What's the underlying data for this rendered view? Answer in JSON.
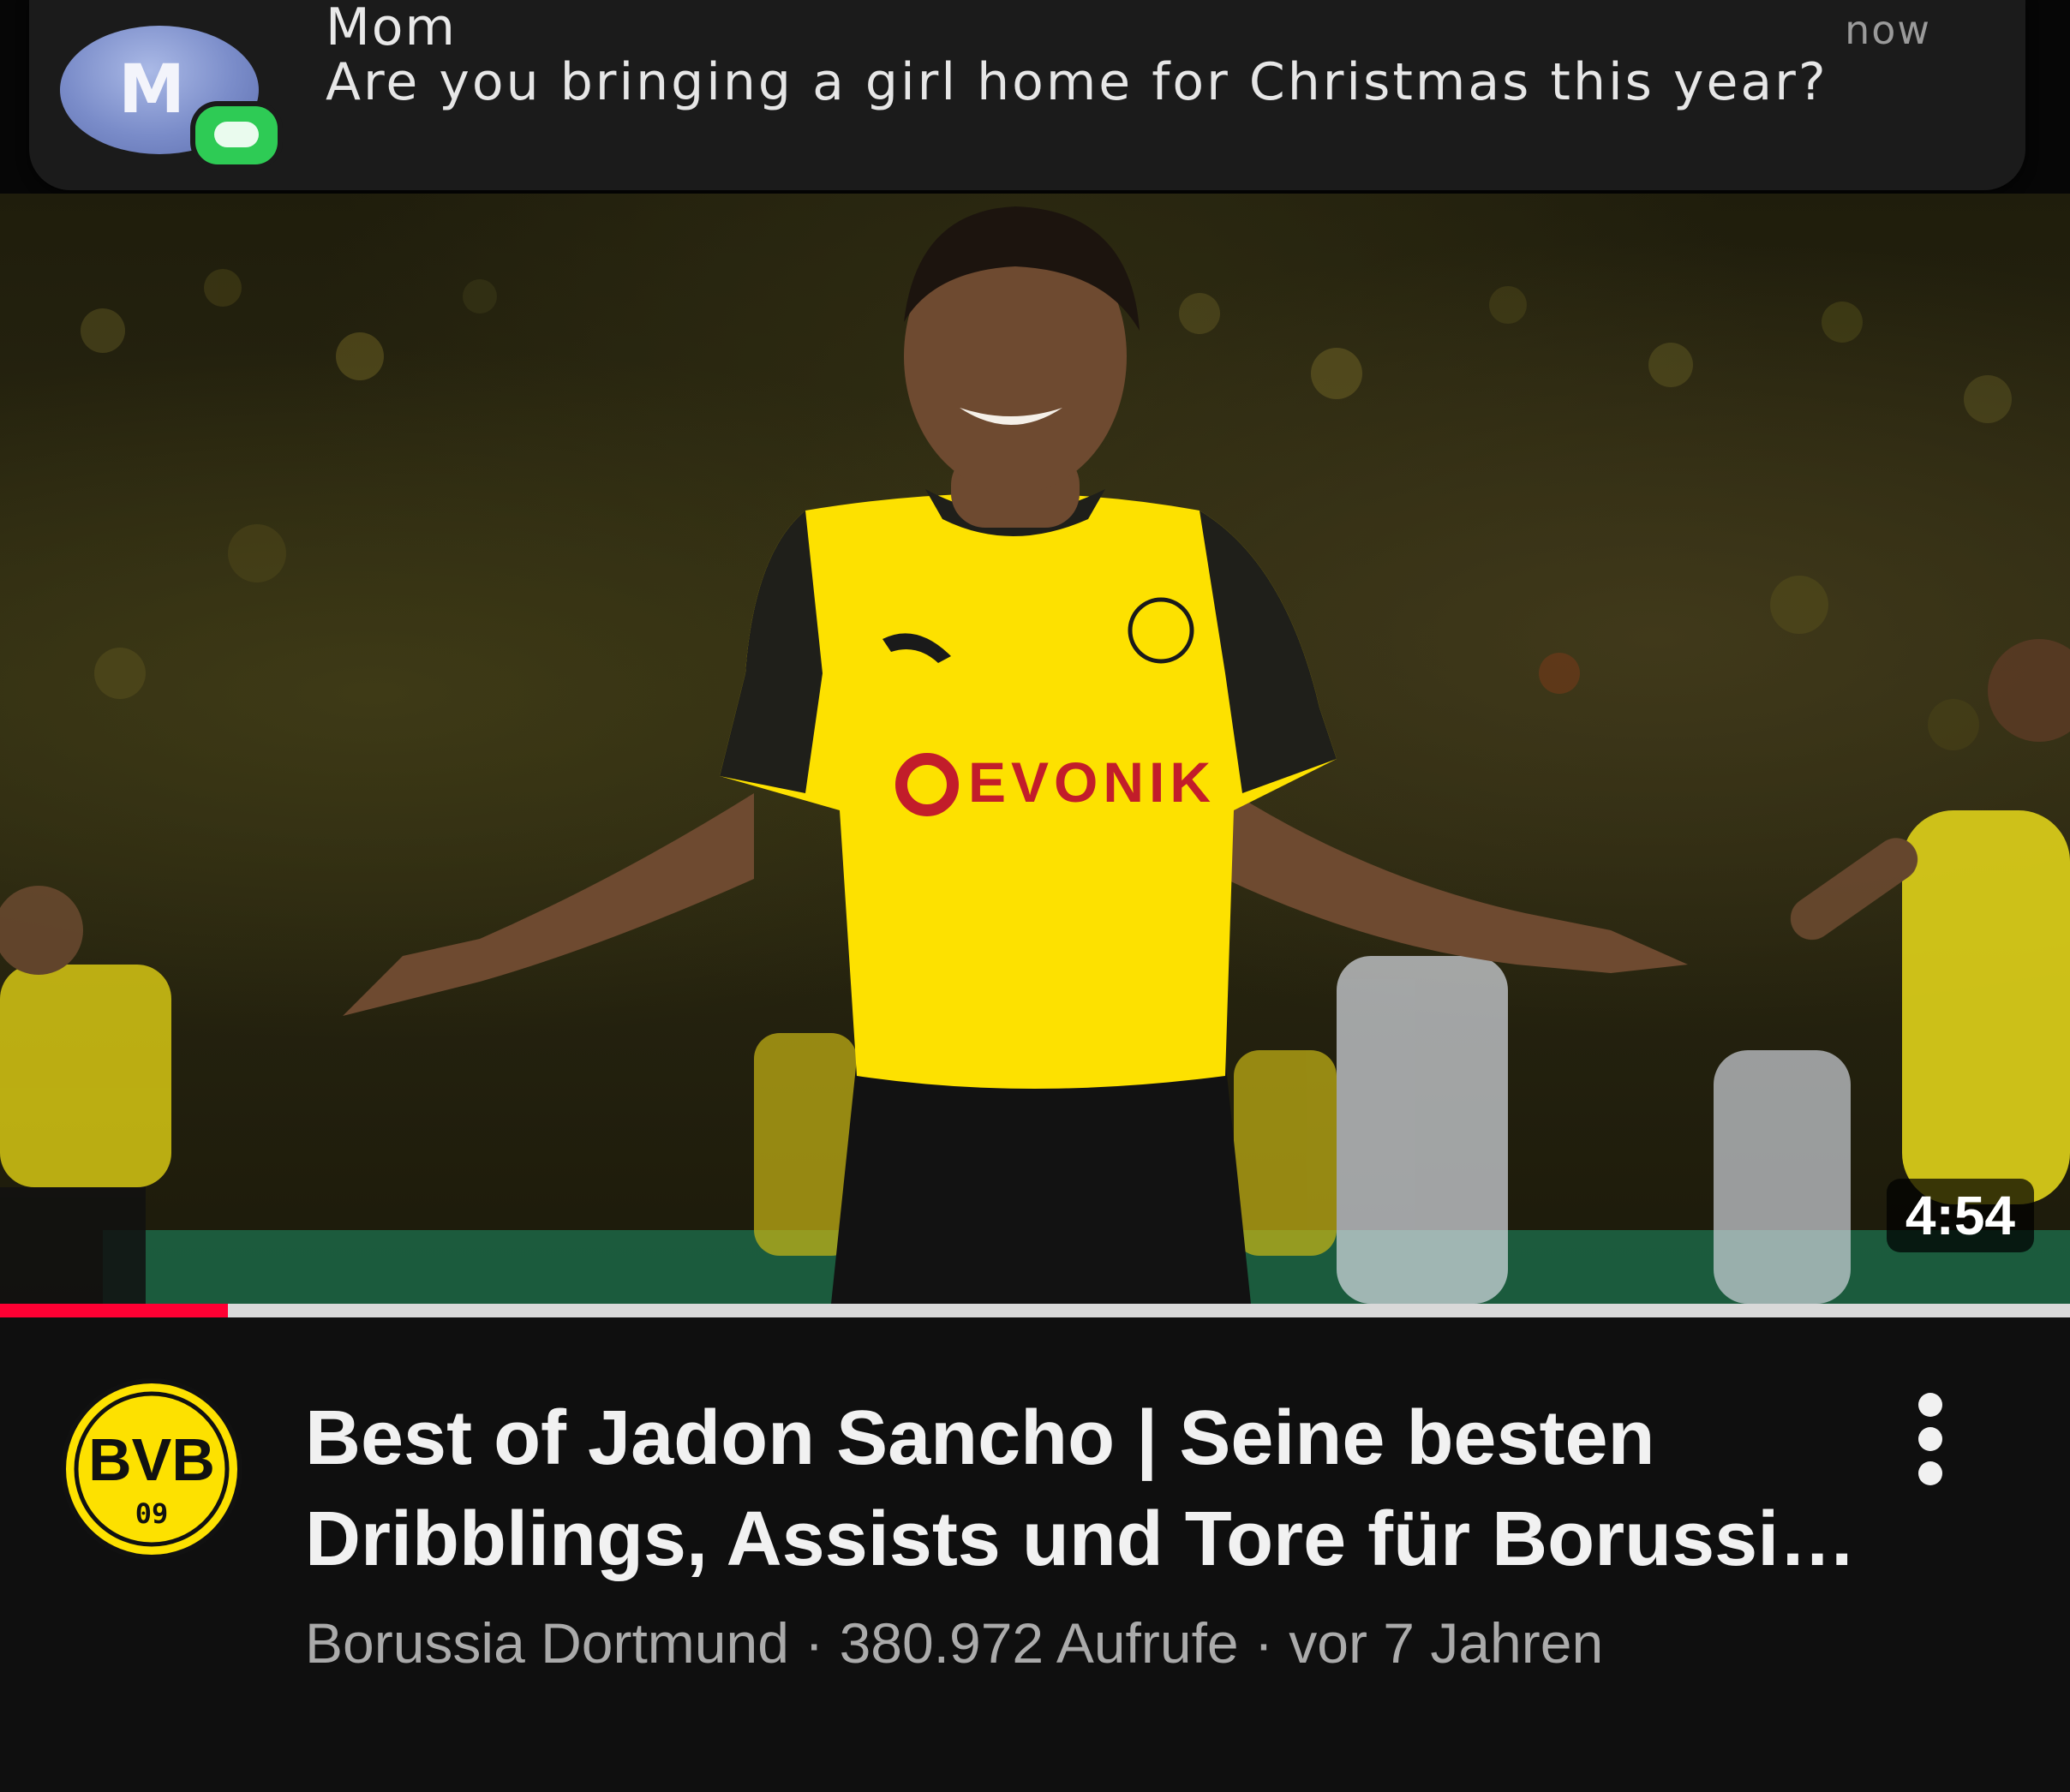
{
  "notification": {
    "sender": "Mom",
    "avatar_letter": "M",
    "time": "now",
    "message": "Are you bringing a girl home for Christmas this year?",
    "app_badge_icon": "messages-icon"
  },
  "video": {
    "duration": "4:54",
    "progress_fraction": 0.11,
    "jersey_sponsor": "EVONIK",
    "title": "Best of Jadon Sancho | Seine besten Dribblings, Assists und Tore für Borussi…",
    "channel": "Borussia Dortmund",
    "views": "380.972 Aufrufe",
    "age": "vor 7 Jahren",
    "separator": " · ",
    "channel_logo_text": "BVB",
    "channel_logo_number": "09",
    "more_icon": "more-vert-icon"
  },
  "colors": {
    "accent_red": "#ff0033",
    "bvb_yellow": "#fde100",
    "background": "#0f0f0f"
  }
}
